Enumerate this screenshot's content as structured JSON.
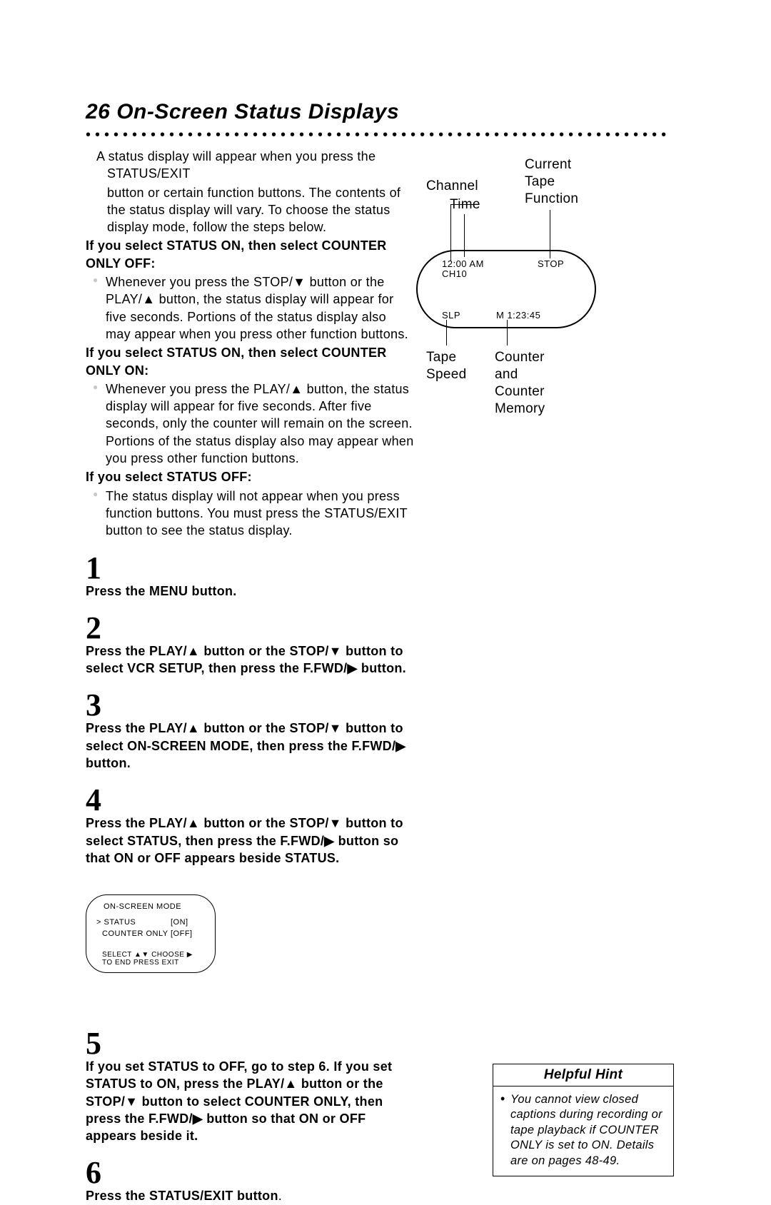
{
  "title": "26  On-Screen Status Displays",
  "intro": {
    "p1": "A status display will appear when you press the STATUS/EXIT",
    "p2": "button or certain function buttons. The contents of the status display will vary. To choose the status display mode, follow the steps below."
  },
  "sections": [
    {
      "head": "If you select STATUS ON, then select COUNTER ONLY OFF:",
      "body": "Whenever you press the STOP/▼ button or the PLAY/▲ button, the status display will appear for five seconds. Portions of the status display also may appear when you press other function buttons."
    },
    {
      "head": "If you select STATUS ON, then select COUNTER ONLY ON:",
      "body": "Whenever you press the PLAY/▲ button, the status display will appear for five seconds. After five seconds, only the counter will remain on the screen. Portions of the status display also may appear when you press other function buttons."
    },
    {
      "head": "If you select STATUS OFF:",
      "body": "The status display will not appear when you press function buttons. You must press the STATUS/EXIT button to see the status display."
    }
  ],
  "steps": {
    "s1": "Press the MENU button.",
    "s2": "Press the PLAY/▲ button or the STOP/▼ button to select VCR SETUP, then press the F.FWD/▶ button.",
    "s3": "Press the PLAY/▲ button or the STOP/▼ button to select ON-SCREEN MODE, then press the F.FWD/▶ button.",
    "s4": "Press the PLAY/▲ button or the STOP/▼ button to select STATUS, then press the F.FWD/▶ button so that ON or OFF appears beside STATUS.",
    "s5": "If you set STATUS to OFF, go to step 6. If you set STATUS to ON, press the PLAY/▲ button or the STOP/▼ button to select COUNTER ONLY, then press the F.FWD/▶ button so that ON or OFF appears beside it.",
    "s6_a": "Press the STATUS/EXIT button",
    "s6_b": "."
  },
  "diagram": {
    "channel": "Channel",
    "time": "Time",
    "current": "Current",
    "tape_fn1": "Tape",
    "tape_fn2": "Function",
    "tv_time": "12:00 AM",
    "tv_ch": "CH10",
    "tv_stop": "STOP",
    "tv_slp": "SLP",
    "tv_counter": "M   1:23:45",
    "tape_speed1": "Tape",
    "tape_speed2": "Speed",
    "cnt1": "Counter",
    "cnt2": "and",
    "cnt3": "Counter",
    "cnt4": "Memory"
  },
  "osd": {
    "title": "ON-SCREEN MODE",
    "row1a": "> STATUS",
    "row1b": "[ON]",
    "row2a": "COUNTER ONLY",
    "row2b": "[OFF]",
    "foot1": "SELECT ▲▼ CHOOSE ▶",
    "foot2": "TO   END   PRESS  EXIT"
  },
  "hint": {
    "head": "Helpful Hint",
    "body": "You cannot view closed captions during recording or tape playback if COUNTER ONLY is set to ON. Details are on pages 48-49."
  }
}
